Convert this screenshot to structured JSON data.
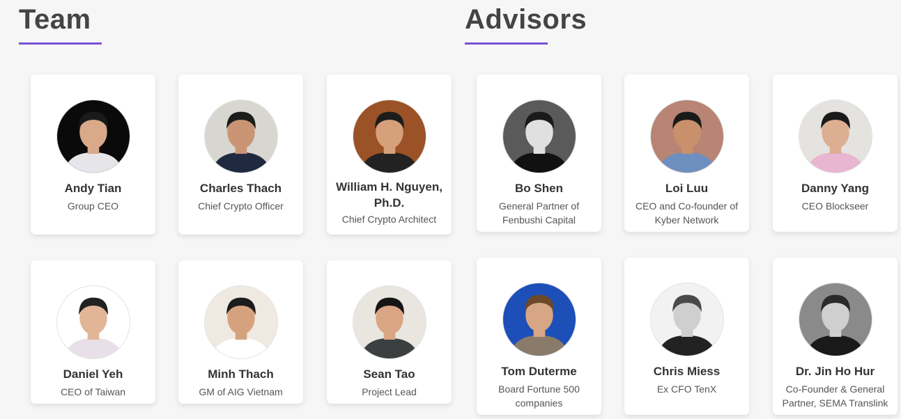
{
  "team": {
    "title": "Team",
    "members": [
      {
        "name": "Andy Tian",
        "role": "Group CEO",
        "colors": {
          "bg": "#0a0a0a",
          "skin": "#d9a98a",
          "hair": "#1a1a1a",
          "shirt": "#e6e6ea"
        }
      },
      {
        "name": "Charles Thach",
        "role": "Chief Crypto Officer",
        "colors": {
          "bg": "#d8d6d0",
          "skin": "#c99474",
          "hair": "#1c1c1c",
          "shirt": "#1f2a40"
        }
      },
      {
        "name": "William H. Nguyen, Ph.D.",
        "role": "Chief Crypto Architect",
        "colors": {
          "bg": "#9a5226",
          "skin": "#d6a07a",
          "hair": "#1c1c1c",
          "shirt": "#222222"
        }
      },
      {
        "name": "Daniel Yeh",
        "role": "CEO of Taiwan",
        "colors": {
          "bg": "#ffffff",
          "skin": "#e2b597",
          "hair": "#222222",
          "shirt": "#e8dfe8"
        }
      },
      {
        "name": "Minh Thach",
        "role": "GM of AIG Vietnam",
        "colors": {
          "bg": "#efe9e2",
          "skin": "#d6a27d",
          "hair": "#1c1c1c",
          "shirt": "#ffffff"
        }
      },
      {
        "name": "Sean Tao",
        "role": "Project Lead",
        "colors": {
          "bg": "#e9e6e0",
          "skin": "#d9a583",
          "hair": "#151515",
          "shirt": "#3b3f3f"
        }
      }
    ]
  },
  "advisors": {
    "title": "Advisors",
    "members": [
      {
        "name": "Bo Shen",
        "role": "General Partner of Fenbushi Capital",
        "colors": {
          "bg": "#5a5a5a",
          "skin": "#e0e0e0",
          "hair": "#1a1a1a",
          "shirt": "#111111"
        }
      },
      {
        "name": "Loi Luu",
        "role": "CEO and Co-founder of Kyber Network",
        "colors": {
          "bg": "#b88473",
          "skin": "#c9906c",
          "hair": "#1a1a1a",
          "shirt": "#6d8fc0"
        }
      },
      {
        "name": "Danny Yang",
        "role": "CEO Blockseer",
        "colors": {
          "bg": "#e5e3e0",
          "skin": "#dcae92",
          "hair": "#1a1a1a",
          "shirt": "#e8b6d0"
        }
      },
      {
        "name": "Tom Duterme",
        "role": "Board Fortune 500 companies",
        "colors": {
          "bg": "#1d4fb8",
          "skin": "#d7a684",
          "hair": "#6b4a2a",
          "shirt": "#8a7a6a"
        }
      },
      {
        "name": "Chris Miess",
        "role": "Ex CFO TenX",
        "colors": {
          "bg": "#f2f2f2",
          "skin": "#cfcfcf",
          "hair": "#4a4a4a",
          "shirt": "#222222"
        }
      },
      {
        "name": "Dr. Jin Ho Hur",
        "role": "Co-Founder & General Partner, SEMA Translink",
        "colors": {
          "bg": "#8a8a8a",
          "skin": "#cfcfcf",
          "hair": "#2a2a2a",
          "shirt": "#1a1a1a"
        }
      }
    ]
  },
  "accent_color": "#7b4fd6"
}
